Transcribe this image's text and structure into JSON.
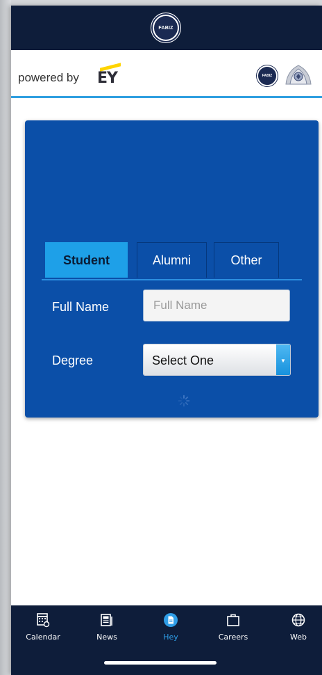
{
  "header": {
    "logo_text": "FABIZ",
    "powered_by": "powered by",
    "brand": "EY",
    "partner_logo_text": "FABIZ"
  },
  "form": {
    "tabs": [
      {
        "label": "Student",
        "active": true
      },
      {
        "label": "Alumni",
        "active": false
      },
      {
        "label": "Other",
        "active": false
      }
    ],
    "full_name_label": "Full Name",
    "full_name_placeholder": "Full Name",
    "full_name_value": "",
    "degree_label": "Degree",
    "degree_selected": "Select One",
    "loading": true
  },
  "bottom_nav": {
    "items": [
      {
        "label": "Calendar",
        "icon": "calendar-icon",
        "active": false
      },
      {
        "label": "News",
        "icon": "newspaper-icon",
        "active": false
      },
      {
        "label": "Hey",
        "icon": "document-icon",
        "active": true
      },
      {
        "label": "Careers",
        "icon": "briefcase-icon",
        "active": false
      },
      {
        "label": "Web",
        "icon": "globe-icon",
        "active": false
      }
    ]
  },
  "colors": {
    "navy": "#0e1d3a",
    "card_blue": "#0b4fa8",
    "accent_blue": "#1ea0e8",
    "active_nav": "#2f9ee8",
    "ey_yellow": "#ffd400"
  }
}
